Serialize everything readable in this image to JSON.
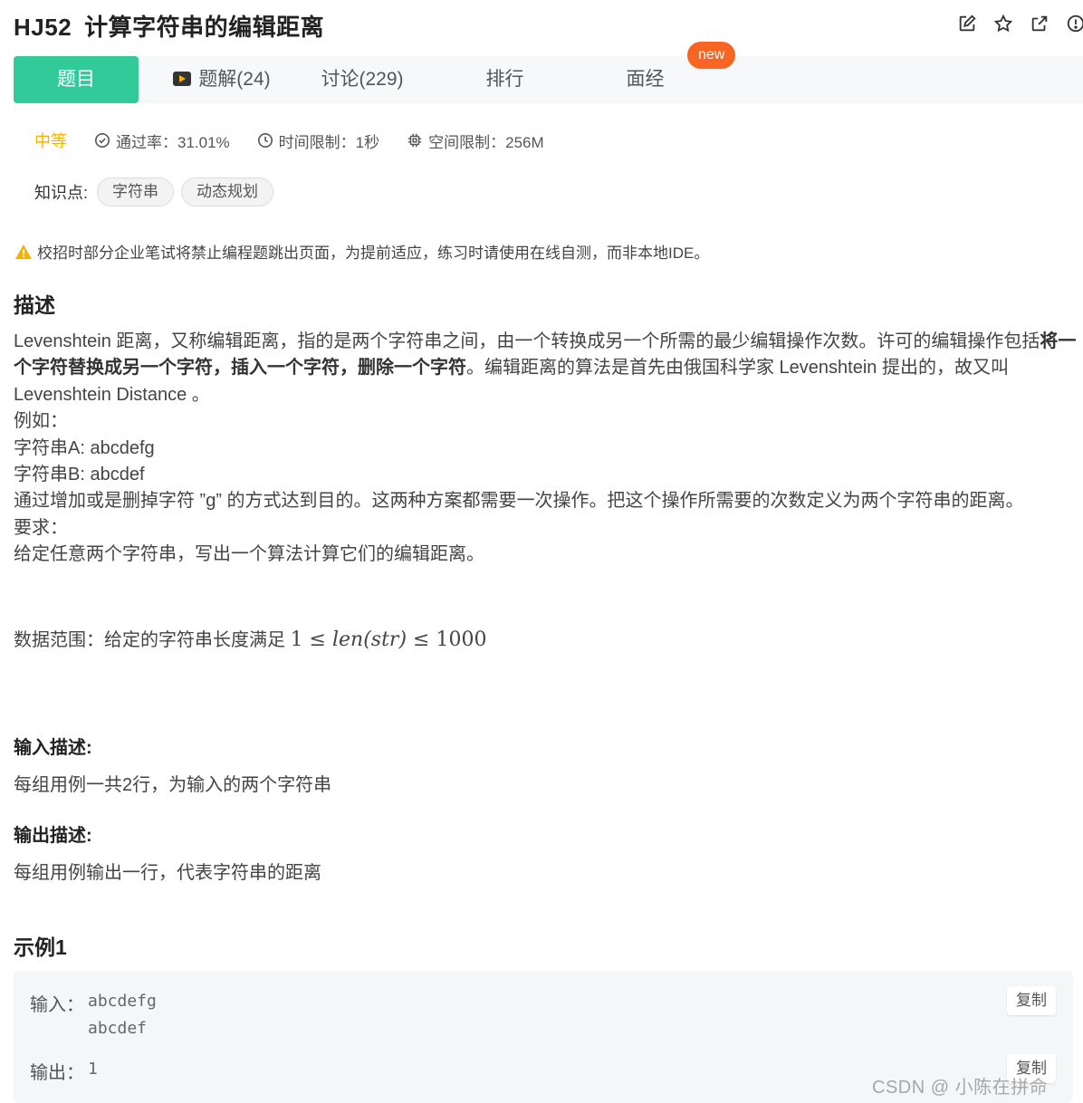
{
  "header": {
    "code": "HJ52",
    "title": "计算字符串的编辑距离",
    "icons": [
      "edit-icon",
      "star-icon",
      "external-link-icon",
      "info-icon"
    ]
  },
  "tabs": {
    "problem": "题目",
    "solutions": "题解(24)",
    "discuss": "讨论(229)",
    "rank": "排行",
    "interview": "面经",
    "new_badge": "new"
  },
  "meta": {
    "difficulty": "中等",
    "pass_rate": "通过率：31.01%",
    "time_limit": "时间限制：1秒",
    "space_limit": "空间限制：256M"
  },
  "knowledge": {
    "label": "知识点:",
    "tags": [
      "字符串",
      "动态规划"
    ]
  },
  "warning": "校招时部分企业笔试将禁止编程题跳出页面，为提前适应，练习时请使用在线自测，而非本地IDE。",
  "description": {
    "heading": "描述",
    "p1_a": "Levenshtein 距离，又称编辑距离，指的是两个字符串之间，由一个转换成另一个所需的最少编辑操作次数。许可的编辑操作包括",
    "p1_bold": "将一个字符替换成另一个字符，插入一个字符，删除一个字符",
    "p1_b": "。编辑距离的算法是首先由俄国科学家 Levenshtein 提出的，故又叫 Levenshtein Distance 。",
    "example_label": "例如：",
    "str_a": "字符串A: abcdefg",
    "str_b": "字符串B: abcdef",
    "explain": "通过增加或是删掉字符 ”g” 的方式达到目的。这两种方案都需要一次操作。把这个操作所需要的次数定义为两个字符串的距离。",
    "require_label": "要求：",
    "require": "给定任意两个字符串，写出一个算法计算它们的编辑距离。",
    "range_prefix": "数据范围：给定的字符串长度满足",
    "range_low": "1",
    "range_expr": "len(str)",
    "range_high": "1000"
  },
  "input_desc": {
    "heading": "输入描述:",
    "text": "每组用例一共2行，为输入的两个字符串"
  },
  "output_desc": {
    "heading": "输出描述:",
    "text": "每组用例输出一行，代表字符串的距离"
  },
  "example1": {
    "heading": "示例1",
    "input_label": "输入：",
    "input_line1": "abcdefg",
    "input_line2": "abcdef",
    "output_label": "输出：",
    "output": "1",
    "copy": "复制"
  },
  "watermark": "CSDN @  小陈在拼命",
  "colors": {
    "accent": "#32ca99",
    "difficulty": "#f5b301",
    "badge": "#fa6422"
  }
}
